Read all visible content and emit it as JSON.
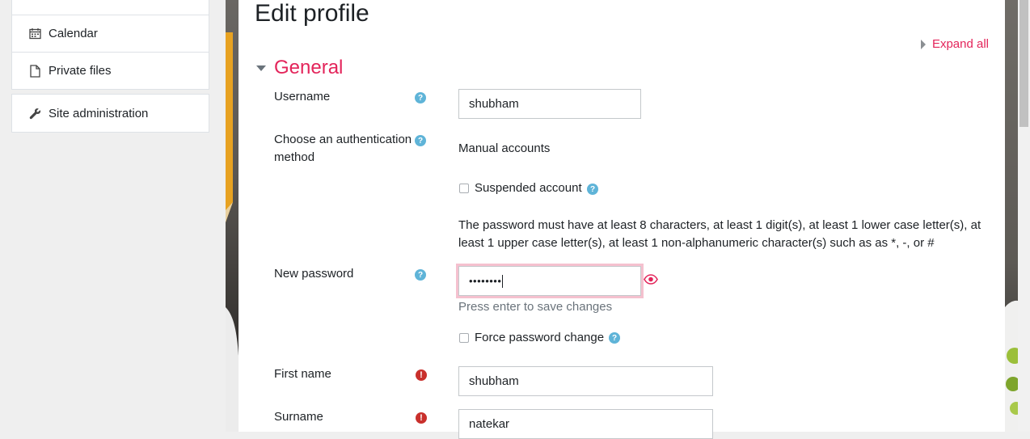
{
  "nav": {
    "items": [
      {
        "label": "Calendar",
        "icon": "calendar-icon"
      },
      {
        "label": "Private files",
        "icon": "file-icon"
      }
    ],
    "admin": {
      "label": "Site administration",
      "icon": "wrench-icon"
    }
  },
  "page": {
    "title": "Edit profile",
    "expand_all": "Expand all",
    "section_title": "General"
  },
  "form": {
    "username": {
      "label": "Username",
      "value": "shubham"
    },
    "auth": {
      "label_line1": "Choose an authentication",
      "label_line2": "method",
      "value": "Manual accounts"
    },
    "suspended": {
      "label": "Suspended account"
    },
    "password_rules": {
      "line1": "The password must have at least 8 characters, at least 1 digit(s), at least 1 lower case letter(s), at",
      "line2": "least 1 upper case letter(s), at least 1 non-alphanumeric character(s) such as as *, -, or #"
    },
    "new_password": {
      "label": "New password",
      "value": "••••••••",
      "hint": "Press enter to save changes"
    },
    "force_change": {
      "label": "Force password change"
    },
    "first_name": {
      "label": "First name",
      "value": "shubham"
    },
    "surname": {
      "label": "Surname",
      "value": "natekar"
    }
  },
  "colors": {
    "accent": "#e3245a",
    "help": "#5fb4d8",
    "required": "#c9302c"
  }
}
